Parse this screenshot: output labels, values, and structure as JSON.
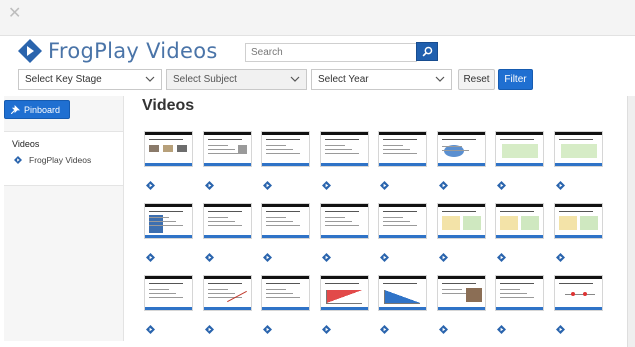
{
  "window": {
    "close_icon": "close-icon"
  },
  "brand": {
    "name": "FrogPlay Videos",
    "color": "#4a74a8",
    "mark_color": "#2a64ad"
  },
  "search": {
    "placeholder": "Search",
    "value": "",
    "button_icon": "search-icon"
  },
  "filters": {
    "key_stage": {
      "placeholder": "Select Key Stage"
    },
    "subject": {
      "placeholder": "Select Subject",
      "disabled": true
    },
    "year": {
      "placeholder": "Select Year"
    },
    "reset_label": "Reset",
    "filter_label": "Filter"
  },
  "sidebar": {
    "pinboard_label": "Pinboard",
    "pinboard_icon": "pin-icon",
    "nav_title": "Videos",
    "nav_items": [
      {
        "label": "FrogPlay Videos",
        "icon": "frogplay-diamond-icon"
      }
    ]
  },
  "main": {
    "title": "Videos"
  },
  "colors": {
    "accent": "#1f6fd1",
    "thumb_bar": "#2f73c7"
  },
  "videos": [
    {
      "style": "photos"
    },
    {
      "style": "text-image"
    },
    {
      "style": "text"
    },
    {
      "style": "text"
    },
    {
      "style": "text"
    },
    {
      "style": "chart-blue"
    },
    {
      "style": "green-box"
    },
    {
      "style": "green-box"
    },
    {
      "style": "text-block"
    },
    {
      "style": "text"
    },
    {
      "style": "text"
    },
    {
      "style": "text"
    },
    {
      "style": "text"
    },
    {
      "style": "yellow-green"
    },
    {
      "style": "yellow-green"
    },
    {
      "style": "yellow-green"
    },
    {
      "style": "text"
    },
    {
      "style": "diagonal"
    },
    {
      "style": "text"
    },
    {
      "style": "red-graph"
    },
    {
      "style": "blue-graph"
    },
    {
      "style": "photo"
    },
    {
      "style": "text"
    },
    {
      "style": "red-dots"
    }
  ]
}
